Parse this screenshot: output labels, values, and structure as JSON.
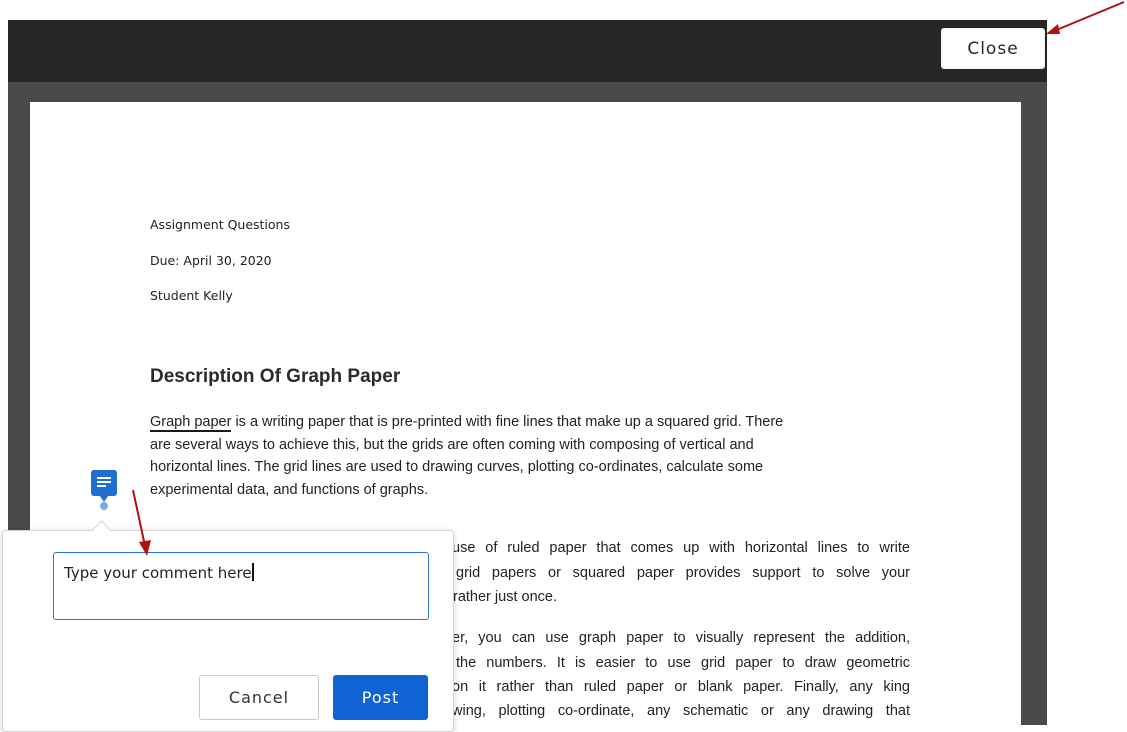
{
  "toolbar": {
    "close_label": "Close"
  },
  "document": {
    "meta": {
      "title": "Assignment Questions",
      "due": "Due:  April 30, 2020",
      "student": "Student Kelly"
    },
    "heading": "Description Of Graph Paper",
    "para1": {
      "highlight": "Graph paper",
      "line1_rest": " is a writing paper that is pre-printed with fine lines that make up a squared grid. There",
      "line2": "are several ways to achieve this, but the grids are often coming with composing of vertical and",
      "line3": "horizontal lines. The grid lines are used to drawing curves, plotting co-ordinates, calculate some",
      "line4": "experimental data, and functions of graphs."
    },
    "para2_visible": [
      "use of ruled paper that comes up with horizontal lines to write",
      "grid papers or squared paper provides support to solve your",
      "rather just once."
    ],
    "para3_visible": [
      "er, you can use graph paper to visually represent the addition,",
      "the numbers. It is easier to use grid paper to draw geometric",
      "on it rather than ruled paper or blank paper. Finally, any king",
      "wing, plotting co-ordinate, any schematic or any drawing that"
    ]
  },
  "comment": {
    "input_value": "Type your comment here",
    "cancel_label": "Cancel",
    "post_label": "Post"
  },
  "colors": {
    "toolbar_bg": "#262626",
    "frame_bg": "#4a4a4a",
    "accent_blue": "#0f63d4",
    "annotation_arrow": "#b01010"
  },
  "icons": {
    "comment_marker": "comment-icon"
  }
}
